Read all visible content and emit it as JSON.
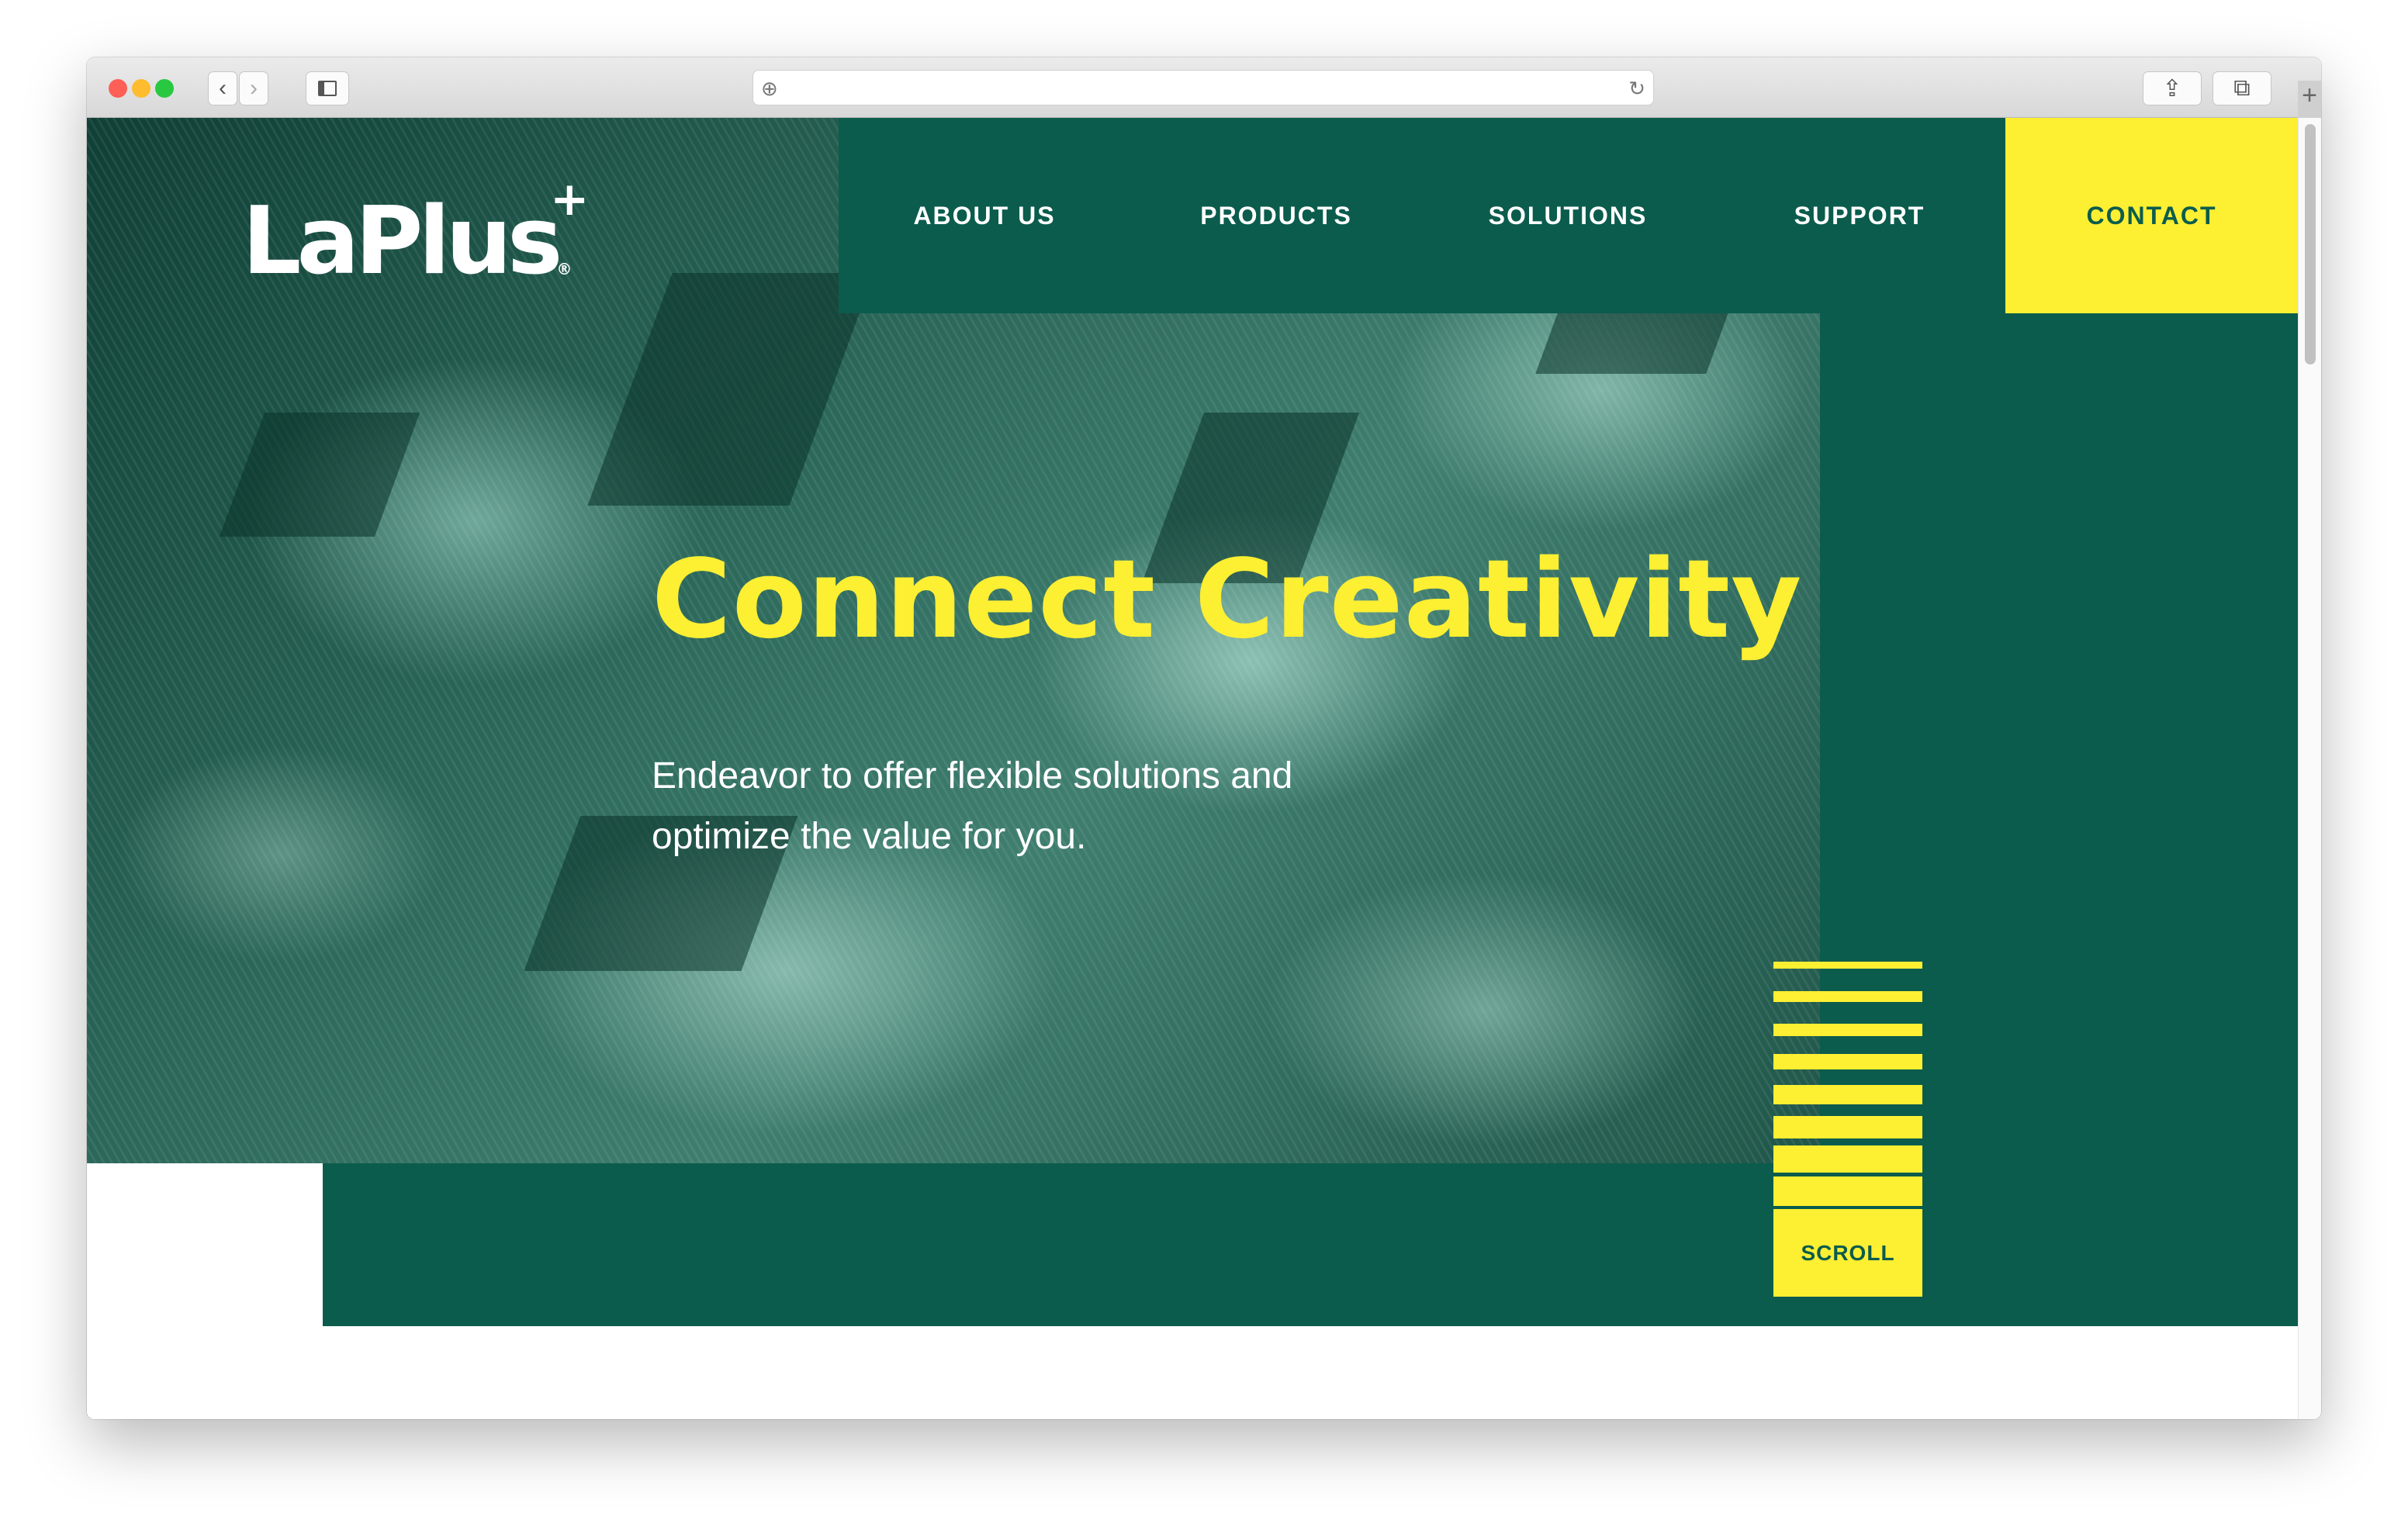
{
  "browser": {
    "back_icon": "‹",
    "forward_icon": "›",
    "sidebar_icon": "sidebar-icon",
    "new_tab_label": "+",
    "reload_icon": "↻",
    "add_icon": "⊕",
    "share_icon": "⇪",
    "tabs_icon": "⧉"
  },
  "brand": {
    "name": "LaPlus",
    "plus": "+",
    "reg": "®"
  },
  "nav": {
    "items": [
      "ABOUT US",
      "PRODUCTS",
      "SOLUTIONS",
      "SUPPORT"
    ],
    "contact": "CONTACT"
  },
  "hero": {
    "title": "Connect Creativity",
    "subtitle": "Endeavor to offer flexible solutions and optimize the value for you."
  },
  "scroll": {
    "label": "SCROLL"
  },
  "colors": {
    "brand_green": "#0b5c4d",
    "accent_yellow": "#fdef32"
  }
}
